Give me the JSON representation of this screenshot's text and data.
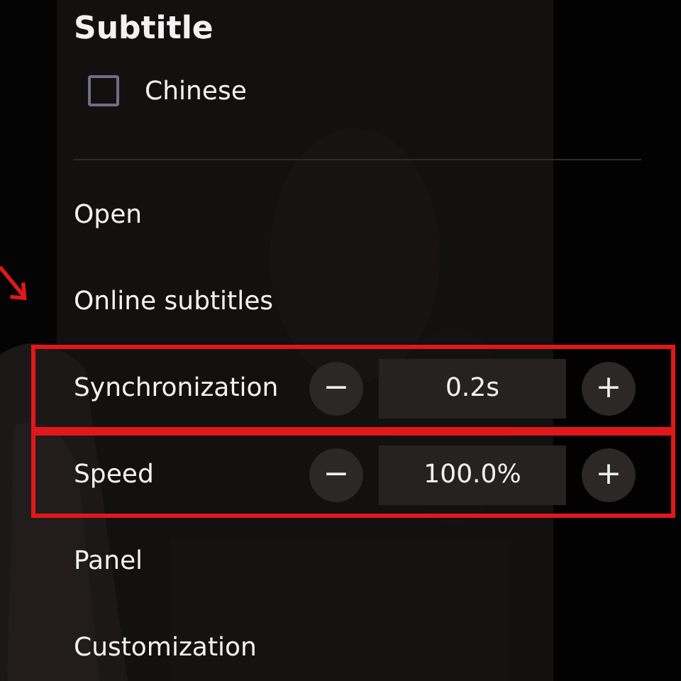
{
  "menu": {
    "title": "Subtitle",
    "languages": [
      {
        "label": "Chinese",
        "checked": false
      }
    ],
    "items": [
      {
        "kind": "link",
        "label": "Open"
      },
      {
        "kind": "link",
        "label": "Online subtitles"
      },
      {
        "kind": "stepper",
        "label": "Synchronization",
        "value": "0.2s",
        "minus": "−",
        "plus": "+",
        "highlighted": true
      },
      {
        "kind": "stepper",
        "label": "Speed",
        "value": "100.0%",
        "minus": "−",
        "plus": "+",
        "highlighted": true
      },
      {
        "kind": "link",
        "label": "Panel"
      },
      {
        "kind": "link",
        "label": "Customization"
      }
    ]
  }
}
